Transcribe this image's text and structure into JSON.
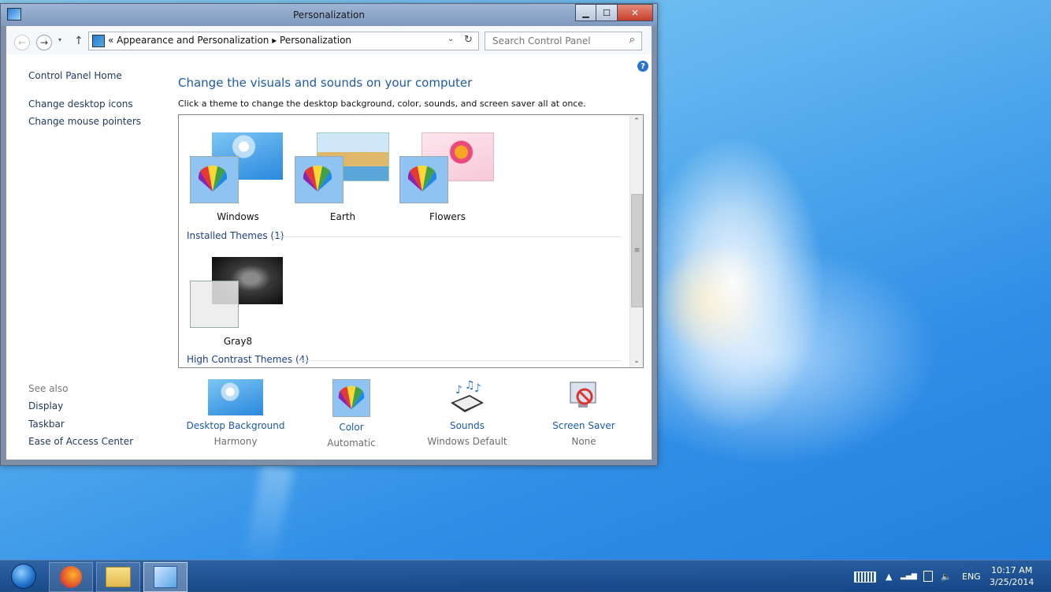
{
  "window": {
    "title": "Personalization",
    "min_glyph": "▁",
    "max_glyph": "☐",
    "close_glyph": "✕"
  },
  "address": {
    "back_glyph": "←",
    "forward_glyph": "→",
    "dropdown_glyph": "▾",
    "up_glyph": "↑",
    "path": "« Appearance and Personalization ▸ Personalization",
    "path_dropdown_glyph": "⌄",
    "refresh_glyph": "↻"
  },
  "search": {
    "placeholder": "Search Control Panel",
    "icon_glyph": "⌕"
  },
  "help_glyph": "?",
  "sidebar": {
    "home": "Control Panel Home",
    "links": [
      "Change desktop icons",
      "Change mouse pointers"
    ],
    "see_also_title": "See also",
    "see_also": [
      "Display",
      "Taskbar",
      "Ease of Access Center"
    ]
  },
  "main": {
    "heading": "Change the visuals and sounds on your computer",
    "subtext": "Click a theme to change the desktop background, color, sounds, and screen saver all at once."
  },
  "themes": {
    "default_themes": [
      "Windows",
      "Earth",
      "Flowers"
    ],
    "installed_header": "Installed Themes (1)",
    "installed_themes": [
      "Gray8"
    ],
    "high_contrast_header": "High Contrast Themes (4)"
  },
  "scrollbar": {
    "up_glyph": "⌃",
    "down_glyph": "⌄",
    "thumb_glyph": "≡"
  },
  "bottom": [
    {
      "label": "Desktop Background",
      "sub": "Harmony"
    },
    {
      "label": "Color",
      "sub": "Automatic"
    },
    {
      "label": "Sounds",
      "sub": "Windows Default"
    },
    {
      "label": "Screen Saver",
      "sub": "None"
    }
  ],
  "taskbar": {
    "tray_expand_glyph": "▲",
    "signal_glyph": "▂▄▆",
    "volume_glyph": "🔈",
    "language": "ENG",
    "time": "10:17 AM",
    "date": "3/25/2014"
  }
}
